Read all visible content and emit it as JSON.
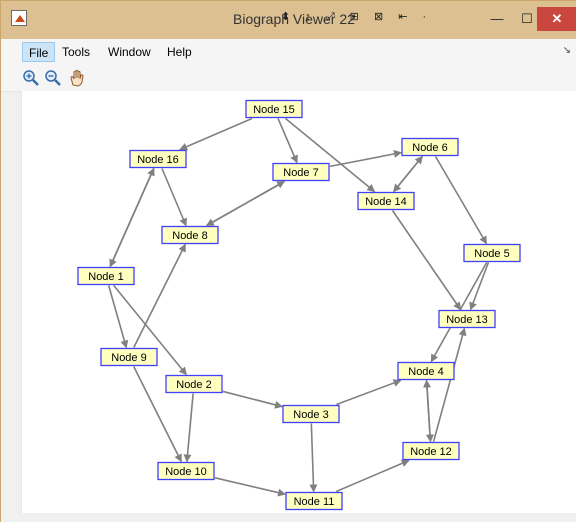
{
  "window": {
    "title": "Biograph Viewer 22",
    "title_glyphs": "⬍ ↕ ⤢ ⊞ ⊠ ⇤ ·",
    "minimize_icon": "minimize-icon",
    "maximize_icon": "maximize-icon",
    "close_icon": "close-icon",
    "minimize_glyph": "—",
    "maximize_glyph": "☐",
    "close_glyph": "✕",
    "accent_color": "#c9473f"
  },
  "menu": {
    "items": [
      {
        "label": "File",
        "active": true
      },
      {
        "label": "Tools"
      },
      {
        "label": "Window"
      },
      {
        "label": "Help"
      }
    ],
    "overflow_glyph": "↘"
  },
  "toolbar": {
    "tools": [
      {
        "name": "zoom-in-icon"
      },
      {
        "name": "zoom-out-icon"
      },
      {
        "name": "pan-hand-icon"
      }
    ]
  },
  "graph": {
    "node_fill": "#ffffc0",
    "node_stroke": "#4040ff",
    "edge_color": "#808080",
    "nodes": [
      {
        "id": "n1",
        "label": "Node 1"
      },
      {
        "id": "n2",
        "label": "Node 2"
      },
      {
        "id": "n3",
        "label": "Node 3"
      },
      {
        "id": "n4",
        "label": "Node 4"
      },
      {
        "id": "n5",
        "label": "Node 5"
      },
      {
        "id": "n6",
        "label": "Node 6"
      },
      {
        "id": "n7",
        "label": "Node 7"
      },
      {
        "id": "n8",
        "label": "Node 8"
      },
      {
        "id": "n9",
        "label": "Node 9"
      },
      {
        "id": "n10",
        "label": "Node 10"
      },
      {
        "id": "n11",
        "label": "Node 11"
      },
      {
        "id": "n12",
        "label": "Node 12"
      },
      {
        "id": "n13",
        "label": "Node 13"
      },
      {
        "id": "n14",
        "label": "Node 14"
      },
      {
        "id": "n15",
        "label": "Node 15"
      },
      {
        "id": "n16",
        "label": "Node 16"
      }
    ],
    "edges": [
      {
        "from": "n15",
        "to": "n16"
      },
      {
        "from": "n15",
        "to": "n7"
      },
      {
        "from": "n15",
        "to": "n14"
      },
      {
        "from": "n16",
        "to": "n1"
      },
      {
        "from": "n1",
        "to": "n16"
      },
      {
        "from": "n16",
        "to": "n8"
      },
      {
        "from": "n7",
        "to": "n6"
      },
      {
        "from": "n7",
        "to": "n8"
      },
      {
        "from": "n8",
        "to": "n7"
      },
      {
        "from": "n14",
        "to": "n6"
      },
      {
        "from": "n6",
        "to": "n14"
      },
      {
        "from": "n6",
        "to": "n5"
      },
      {
        "from": "n14",
        "to": "n13"
      },
      {
        "from": "n5",
        "to": "n13"
      },
      {
        "from": "n5",
        "to": "n4"
      },
      {
        "from": "n1",
        "to": "n9"
      },
      {
        "from": "n1",
        "to": "n2"
      },
      {
        "from": "n9",
        "to": "n8"
      },
      {
        "from": "n9",
        "to": "n10"
      },
      {
        "from": "n2",
        "to": "n10"
      },
      {
        "from": "n2",
        "to": "n3"
      },
      {
        "from": "n3",
        "to": "n4"
      },
      {
        "from": "n3",
        "to": "n11"
      },
      {
        "from": "n4",
        "to": "n12"
      },
      {
        "from": "n12",
        "to": "n4"
      },
      {
        "from": "n12",
        "to": "n13"
      },
      {
        "from": "n10",
        "to": "n11"
      },
      {
        "from": "n11",
        "to": "n12"
      }
    ]
  }
}
